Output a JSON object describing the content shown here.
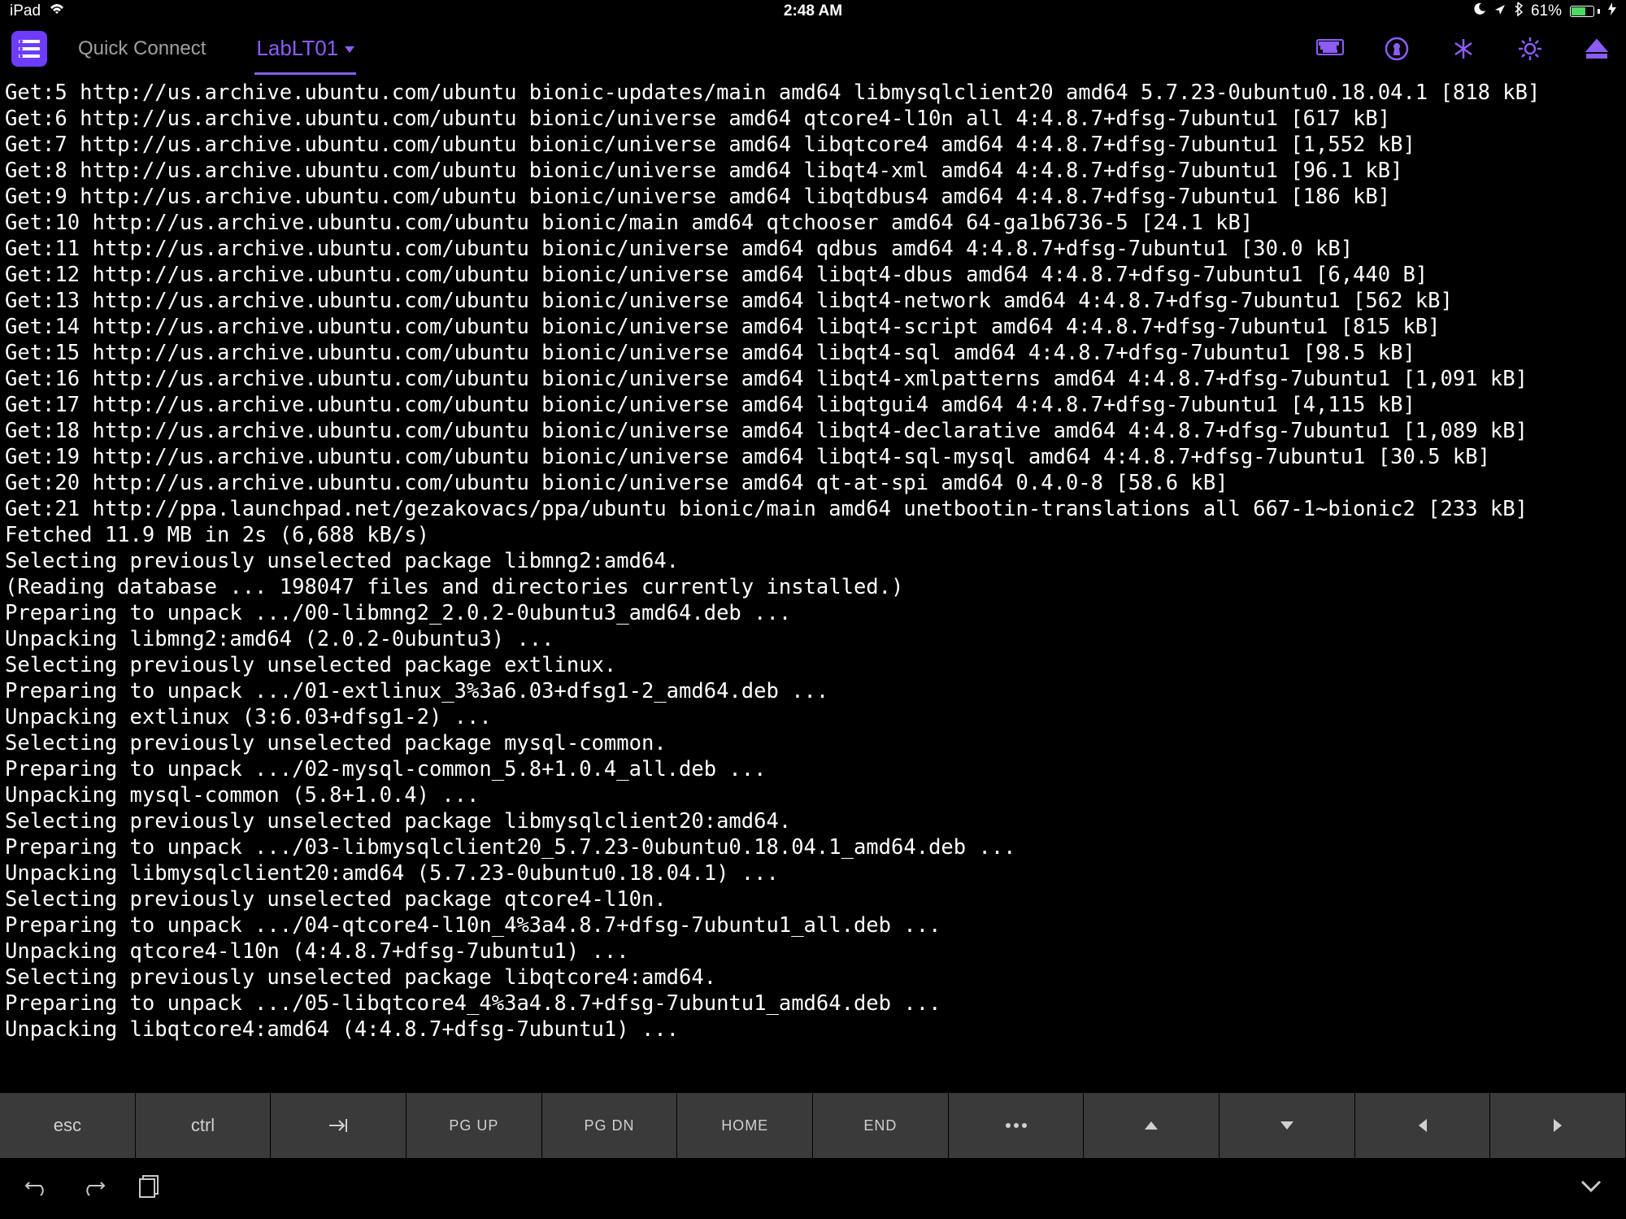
{
  "statusbar": {
    "device": "iPad",
    "time": "2:48 AM",
    "battery_pct": "61%"
  },
  "toolbar": {
    "quick_connect": "Quick Connect",
    "tab_label": "LabLT01"
  },
  "terminal_lines": [
    "Get:5 http://us.archive.ubuntu.com/ubuntu bionic-updates/main amd64 libmysqlclient20 amd64 5.7.23-0ubuntu0.18.04.1 [818 kB]",
    "Get:6 http://us.archive.ubuntu.com/ubuntu bionic/universe amd64 qtcore4-l10n all 4:4.8.7+dfsg-7ubuntu1 [617 kB]",
    "Get:7 http://us.archive.ubuntu.com/ubuntu bionic/universe amd64 libqtcore4 amd64 4:4.8.7+dfsg-7ubuntu1 [1,552 kB]",
    "Get:8 http://us.archive.ubuntu.com/ubuntu bionic/universe amd64 libqt4-xml amd64 4:4.8.7+dfsg-7ubuntu1 [96.1 kB]",
    "Get:9 http://us.archive.ubuntu.com/ubuntu bionic/universe amd64 libqtdbus4 amd64 4:4.8.7+dfsg-7ubuntu1 [186 kB]",
    "Get:10 http://us.archive.ubuntu.com/ubuntu bionic/main amd64 qtchooser amd64 64-ga1b6736-5 [24.1 kB]",
    "Get:11 http://us.archive.ubuntu.com/ubuntu bionic/universe amd64 qdbus amd64 4:4.8.7+dfsg-7ubuntu1 [30.0 kB]",
    "Get:12 http://us.archive.ubuntu.com/ubuntu bionic/universe amd64 libqt4-dbus amd64 4:4.8.7+dfsg-7ubuntu1 [6,440 B]",
    "Get:13 http://us.archive.ubuntu.com/ubuntu bionic/universe amd64 libqt4-network amd64 4:4.8.7+dfsg-7ubuntu1 [562 kB]",
    "Get:14 http://us.archive.ubuntu.com/ubuntu bionic/universe amd64 libqt4-script amd64 4:4.8.7+dfsg-7ubuntu1 [815 kB]",
    "Get:15 http://us.archive.ubuntu.com/ubuntu bionic/universe amd64 libqt4-sql amd64 4:4.8.7+dfsg-7ubuntu1 [98.5 kB]",
    "Get:16 http://us.archive.ubuntu.com/ubuntu bionic/universe amd64 libqt4-xmlpatterns amd64 4:4.8.7+dfsg-7ubuntu1 [1,091 kB]",
    "Get:17 http://us.archive.ubuntu.com/ubuntu bionic/universe amd64 libqtgui4 amd64 4:4.8.7+dfsg-7ubuntu1 [4,115 kB]",
    "Get:18 http://us.archive.ubuntu.com/ubuntu bionic/universe amd64 libqt4-declarative amd64 4:4.8.7+dfsg-7ubuntu1 [1,089 kB]",
    "Get:19 http://us.archive.ubuntu.com/ubuntu bionic/universe amd64 libqt4-sql-mysql amd64 4:4.8.7+dfsg-7ubuntu1 [30.5 kB]",
    "Get:20 http://us.archive.ubuntu.com/ubuntu bionic/universe amd64 qt-at-spi amd64 0.4.0-8 [58.6 kB]",
    "Get:21 http://ppa.launchpad.net/gezakovacs/ppa/ubuntu bionic/main amd64 unetbootin-translations all 667-1~bionic2 [233 kB]",
    "Fetched 11.9 MB in 2s (6,688 kB/s)",
    "Selecting previously unselected package libmng2:amd64.",
    "(Reading database ... 198047 files and directories currently installed.)",
    "Preparing to unpack .../00-libmng2_2.0.2-0ubuntu3_amd64.deb ...",
    "Unpacking libmng2:amd64 (2.0.2-0ubuntu3) ...",
    "Selecting previously unselected package extlinux.",
    "Preparing to unpack .../01-extlinux_3%3a6.03+dfsg1-2_amd64.deb ...",
    "Unpacking extlinux (3:6.03+dfsg1-2) ...",
    "Selecting previously unselected package mysql-common.",
    "Preparing to unpack .../02-mysql-common_5.8+1.0.4_all.deb ...",
    "Unpacking mysql-common (5.8+1.0.4) ...",
    "Selecting previously unselected package libmysqlclient20:amd64.",
    "Preparing to unpack .../03-libmysqlclient20_5.7.23-0ubuntu0.18.04.1_amd64.deb ...",
    "Unpacking libmysqlclient20:amd64 (5.7.23-0ubuntu0.18.04.1) ...",
    "Selecting previously unselected package qtcore4-l10n.",
    "Preparing to unpack .../04-qtcore4-l10n_4%3a4.8.7+dfsg-7ubuntu1_all.deb ...",
    "Unpacking qtcore4-l10n (4:4.8.7+dfsg-7ubuntu1) ...",
    "Selecting previously unselected package libqtcore4:amd64.",
    "Preparing to unpack .../05-libqtcore4_4%3a4.8.7+dfsg-7ubuntu1_amd64.deb ...",
    "Unpacking libqtcore4:amd64 (4:4.8.7+dfsg-7ubuntu1) ..."
  ],
  "keys": {
    "esc": "esc",
    "ctrl": "ctrl",
    "pgup": "PG UP",
    "pgdn": "PG DN",
    "home": "HOME",
    "end": "END"
  },
  "colors": {
    "accent": "#8b5cf6",
    "menu_bg": "#6e3cff",
    "key_bg": "#3a3a3a"
  }
}
